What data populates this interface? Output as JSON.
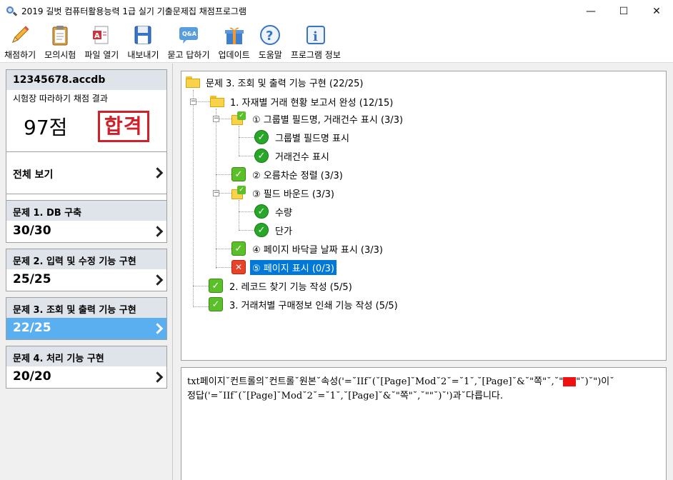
{
  "window": {
    "title": "2019 길벗 컴퓨터활용능력 1급 실기 기출문제집 채점프로그램",
    "minimize": "—",
    "maximize": "☐",
    "close": "✕"
  },
  "toolbar": [
    {
      "label": "채점하기",
      "icon": "pencil-icon"
    },
    {
      "label": "모의시험",
      "icon": "clipboard-icon"
    },
    {
      "label": "파일 열기",
      "icon": "open-file-icon"
    },
    {
      "label": "내보내기",
      "icon": "floppy-disk-icon"
    },
    {
      "label": "묻고 답하기",
      "icon": "qa-bubble-icon"
    },
    {
      "label": "업데이트",
      "icon": "gift-box-icon"
    },
    {
      "label": "도움말",
      "icon": "help-icon"
    },
    {
      "label": "프로그램 정보",
      "icon": "info-icon"
    }
  ],
  "score": {
    "file": "12345678.accdb",
    "subtitle": "시험장 따라하기 채점 결과",
    "points": "97점",
    "result": "합격"
  },
  "nav": {
    "all_view": "전체 보기",
    "items": [
      {
        "title": "문제 1. DB 구축",
        "score": "30/30"
      },
      {
        "title": "문제 2. 입력 및 수정 기능 구현",
        "score": "25/25"
      },
      {
        "title": "문제 3. 조회 및 출력 기능 구현",
        "score": "22/25"
      },
      {
        "title": "문제 4. 처리 기능 구현",
        "score": "20/20"
      }
    ]
  },
  "tree": {
    "root": "문제 3. 조회 및 출력 기능 구현 (22/25)",
    "n1": "1. 자재별 거래 현황 보고서 완성 (12/15)",
    "n1_1": "① 그룹별 필드명, 거래건수 표시 (3/3)",
    "n1_1_a": "그룹별 필드명 표시",
    "n1_1_b": "거래건수 표시",
    "n1_2": "② 오름차순 정렬 (3/3)",
    "n1_3": "③ 필드 바운드 (3/3)",
    "n1_3_a": "수량",
    "n1_3_b": "단가",
    "n1_4": "④ 페이지 바닥글 날짜 표시 (3/3)",
    "n1_5": "⑤ 페이지 표시 (0/3)",
    "n2": "2. 레코드 찾기 기능 작성 (5/5)",
    "n3": "3. 거래처별 구매정보 인쇄 기능 작성 (5/5)"
  },
  "detail": {
    "line1_a": "txt페이지˘컨트롤의˘컨트롤˘원본˘속성('=˘IIf˘(˘[Page]˘Mod˘2˘=˘1˘,˘[Page]˘&˘\"쪽\"˘,˘\"",
    "line1_b": "\"˘)˘\")이˘",
    "line2": "정답('=˘IIf˘(˘[Page]˘Mod˘2˘=˘1˘,˘[Page]˘&˘\"쪽\"˘,˘\"\"˘)˘')과˘다릅니다."
  }
}
